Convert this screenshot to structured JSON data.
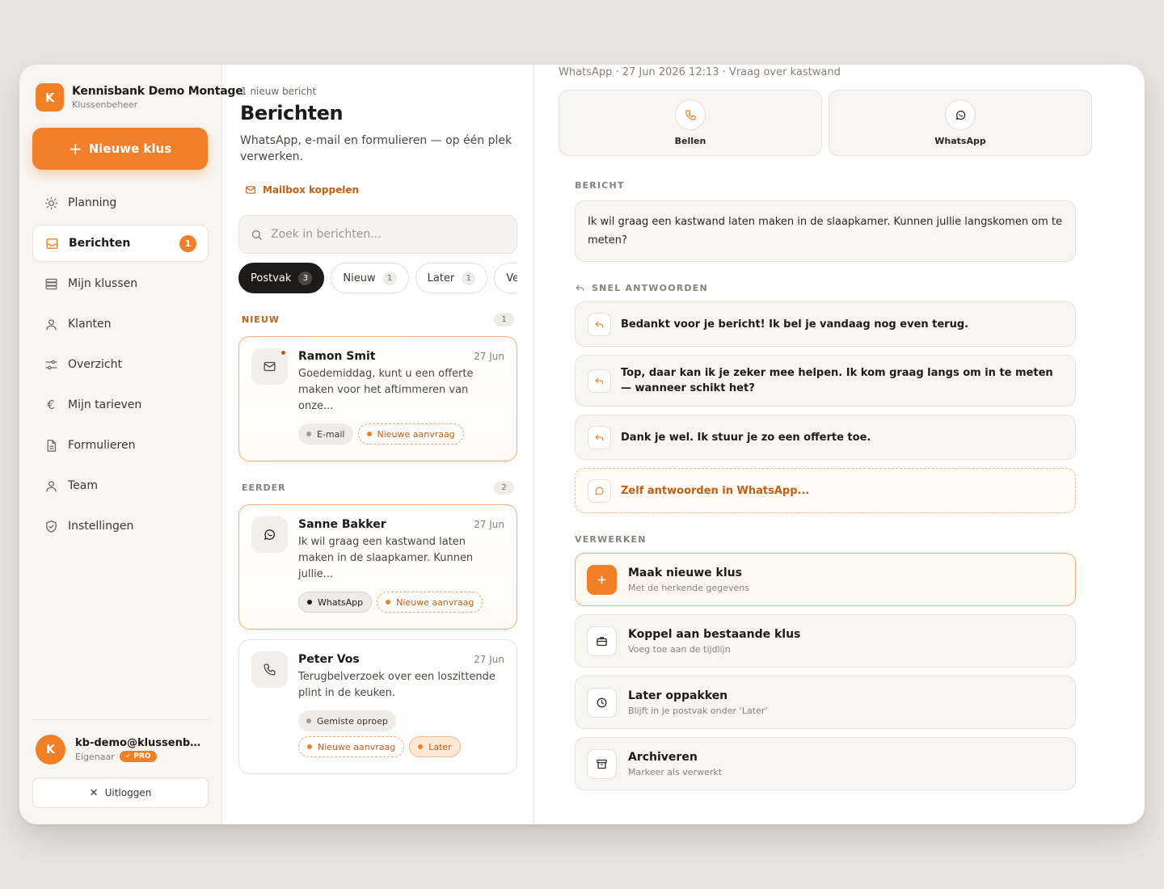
{
  "brand": {
    "logo_letter": "K",
    "name": "Kennisbank Demo Montage",
    "subtitle": "Klussenbeheer"
  },
  "sidebar": {
    "new_button": "Nieuwe klus",
    "items": [
      {
        "label": "Planning",
        "icon": "sun-icon"
      },
      {
        "label": "Berichten",
        "icon": "inbox-icon",
        "badge": "1"
      },
      {
        "label": "Mijn klussen",
        "icon": "stack-icon"
      },
      {
        "label": "Klanten",
        "icon": "user-icon"
      },
      {
        "label": "Overzicht",
        "icon": "sliders-icon"
      },
      {
        "label": "Mijn tarieven",
        "icon": "euro-icon"
      },
      {
        "label": "Formulieren",
        "icon": "document-icon"
      },
      {
        "label": "Team",
        "icon": "user-icon"
      },
      {
        "label": "Instellingen",
        "icon": "shield-icon"
      }
    ],
    "user": {
      "avatar_letter": "K",
      "email": "kb-demo@klussenbeheer.nl",
      "role": "Eigenaar",
      "plan": "✓ PRO"
    },
    "logout": "Uitloggen"
  },
  "list": {
    "new_count": "1 nieuw bericht",
    "title": "Berichten",
    "description": "WhatsApp, e-mail en formulieren — op één plek verwerken.",
    "mailbox_link": "Mailbox koppelen",
    "search_placeholder": "Zoek in berichten...",
    "filters": [
      {
        "label": "Postvak",
        "count": "3"
      },
      {
        "label": "Nieuw",
        "count": "1"
      },
      {
        "label": "Later",
        "count": "1"
      },
      {
        "label": "Verwerkt",
        "count": ""
      }
    ],
    "sections": {
      "new": {
        "label": "NIEUW",
        "count": "1"
      },
      "earlier": {
        "label": "EERDER",
        "count": "2"
      }
    },
    "messages": [
      {
        "name": "Ramon Smit",
        "date": "27 Jun",
        "text": "Goedemiddag, kunt u een offerte maken voor het aftimmeren van onze...",
        "channel_icon": "mail-icon",
        "tags": [
          "E-mail",
          "Nieuwe aanvraag"
        ]
      },
      {
        "name": "Sanne Bakker",
        "date": "27 Jun",
        "text": "Ik wil graag een kastwand laten maken in de slaapkamer. Kunnen jullie...",
        "channel_icon": "whatsapp-icon",
        "tags": [
          "WhatsApp",
          "Nieuwe aanvraag"
        ]
      },
      {
        "name": "Peter Vos",
        "date": "27 Jun",
        "text": "Terugbelverzoek over een loszittende plint in de keuken.",
        "channel_icon": "phone-icon",
        "tags": [
          "Gemiste oproep",
          "Nieuwe aanvraag",
          "Later"
        ]
      }
    ]
  },
  "detail": {
    "meta": "WhatsApp · 27 Jun 2026 12:13 · Vraag over kastwand",
    "actions": {
      "call": "Bellen",
      "whatsapp": "WhatsApp"
    },
    "message_caption": "BERICHT",
    "message": "Ik wil graag een kastwand laten maken in de slaapkamer. Kunnen jullie langskomen om te meten?",
    "quick_caption": "SNEL ANTWOORDEN",
    "quick_replies": [
      "Bedankt voor je bericht! Ik bel je vandaag nog even terug.",
      "Top, daar kan ik je zeker mee helpen. Ik kom graag langs om in te meten — wanneer schikt het?",
      "Dank je wel. Ik stuur je zo een offerte toe."
    ],
    "own_reply": "Zelf antwoorden in WhatsApp...",
    "process_caption": "VERWERKEN",
    "process": [
      {
        "title": "Maak nieuwe klus",
        "sub": "Met de herkende gegevens"
      },
      {
        "title": "Koppel aan bestaande klus",
        "sub": "Voeg toe aan de tijdlijn"
      },
      {
        "title": "Later oppakken",
        "sub": "Blijft in je postvak onder ‘Later’"
      },
      {
        "title": "Archiveren",
        "sub": "Markeer als verwerkt"
      }
    ]
  },
  "colors": {
    "accent": "#f07f25",
    "accent_text": "#c25f14"
  }
}
